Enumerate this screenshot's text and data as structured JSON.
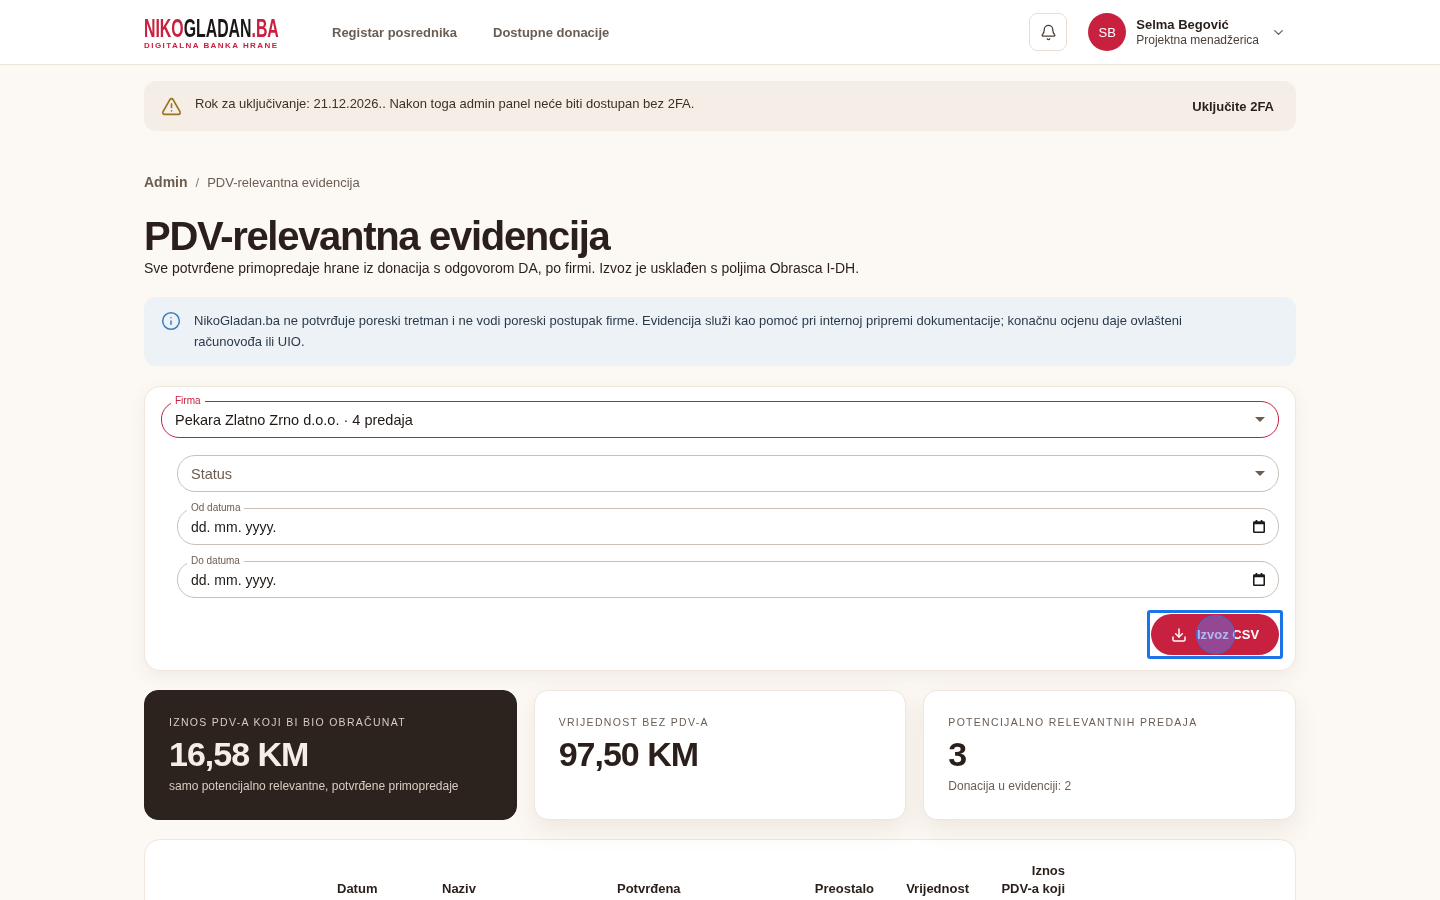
{
  "header": {
    "logo": {
      "parts": [
        {
          "text": "NIKO",
          "color": "#c8203f"
        },
        {
          "text": "GLADAN",
          "color": "#1c1717"
        },
        {
          "text": ".BA",
          "color": "#c8203f"
        }
      ],
      "tagline": "DIGITALNA BANKA HRANE"
    },
    "nav": [
      "Registar posrednika",
      "Dostupne donacije"
    ],
    "user": {
      "initials": "SB",
      "name": "Selma Begović",
      "role": "Projektna menadžerica"
    }
  },
  "banner": {
    "message": "Rok za uključivanje: 21.12.2026.. Nakon toga admin panel neće biti dostupan bez 2FA.",
    "action": "Uključite 2FA"
  },
  "breadcrumbs": {
    "separator": "/",
    "items": [
      {
        "label": "Admin",
        "kind": "link"
      },
      {
        "label": "PDV-relevantna evidencija",
        "kind": "current"
      }
    ]
  },
  "page": {
    "title": "PDV-relevantna evidencija",
    "subtitle": "Sve potvrđene primopredaje hrane iz donacija s odgovorom DA, po firmi. Izvoz je usklađen s poljima Obrasca I-DH."
  },
  "notice": {
    "text": "NikoGladan.ba ne potvrđuje poreski tretman i ne vodi poreski postupak firme. Evidencija služi kao pomoć pri internoj pripremi dokumentacije; konačnu ocjenu daje ovlašteni računovođa ili UIO."
  },
  "form": {
    "company": {
      "label": "Firma",
      "value": "Pekara Zlatno Zrno d.o.o. · 4 predaja",
      "focused": true
    },
    "filters": [
      {
        "kind": "select",
        "placeholder": "Status"
      },
      {
        "kind": "date",
        "label": "Od datuma",
        "placeholder": "dd. mm. yyyy."
      },
      {
        "kind": "date",
        "label": "Do datuma",
        "placeholder": "dd. mm. yyyy."
      }
    ],
    "export_button": {
      "label": "Izvoz CSV",
      "focused": true,
      "pressed": true
    }
  },
  "stats": [
    {
      "label": "IZNOS PDV-A KOJI BI BIO OBRAČUNAT",
      "value": "16,58 KM",
      "note": "samo potencijalno relevantne, potvrđene primopredaje",
      "highlighted": true
    },
    {
      "label": "VRIJEDNOST BEZ PDV-A",
      "value": "97,50 KM",
      "highlighted": false
    },
    {
      "label": "POTENCIJALNO RELEVANTNIH PREDAJA",
      "value": "3",
      "note": "Donacija u evidenciji: 2",
      "highlighted": false
    }
  ],
  "table": {
    "columns": [
      {
        "label": "Datum",
        "kind": "text"
      },
      {
        "label": "Naziv",
        "kind": "text"
      },
      {
        "label": "Potvrđena",
        "kind": "text"
      },
      {
        "label": "Preostalo",
        "kind": "number"
      },
      {
        "label": "Vrijednost",
        "kind": "number"
      },
      {
        "label": "Iznos PDV-a koji",
        "kind": "number"
      }
    ]
  }
}
